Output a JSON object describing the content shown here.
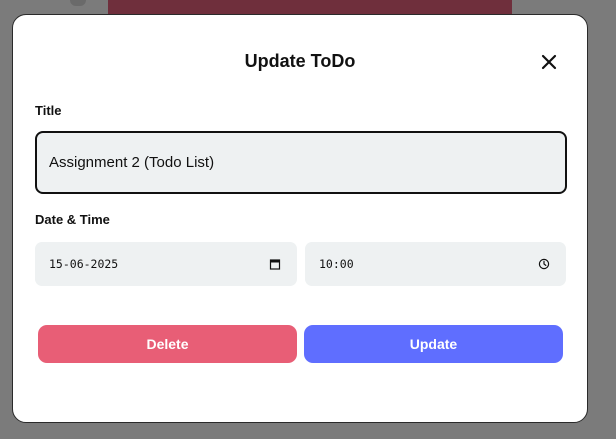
{
  "modal": {
    "title": "Update ToDo",
    "close_icon": "close-icon",
    "title_label": "Title",
    "title_value": "Assignment 2 (Todo List)",
    "datetime_label": "Date & Time",
    "date_value": "15-06-2025",
    "date_icon": "calendar-icon",
    "time_value": "10:00",
    "time_icon": "clock-icon",
    "delete_label": "Delete",
    "update_label": "Update"
  },
  "colors": {
    "delete": "#e85e76",
    "update": "#5f6eff",
    "overlay": "#7b7b7b",
    "field_bg": "#eef1f2"
  }
}
